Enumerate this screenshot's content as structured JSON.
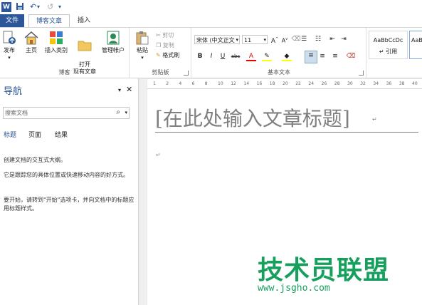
{
  "qat": {
    "undo_glyph": "↶",
    "redo_glyph": "↺",
    "dropdown_glyph": "▾"
  },
  "tabs": {
    "file": "文件",
    "blog": "博客文章",
    "insert": "插入"
  },
  "ribbon": {
    "blog_group": {
      "label": "博客",
      "publish": "发布",
      "home": "主页",
      "insert_category": "插入类别",
      "open_existing": "打开\n现有文章",
      "manage_accounts": "管理帐户"
    },
    "clipboard": {
      "label": "剪贴板",
      "paste": "粘贴",
      "cut": "剪切",
      "copy": "复制",
      "format_painter": "格式刷"
    },
    "basic_text": {
      "label": "基本文本",
      "font_name": "宋体 (中文正文",
      "font_size": "11",
      "bold": "B",
      "italic": "I",
      "underline": "U",
      "strike": "abc"
    },
    "styles": {
      "style1_sample": "AaBbCcDc",
      "style1_name": "↵ 引用",
      "style2_sample": "AaB"
    }
  },
  "nav": {
    "title": "导航",
    "search_placeholder": "搜索文档",
    "tabs": [
      "标题",
      "页面",
      "结果"
    ],
    "line1": "创建文档的交互式大纲。",
    "line2": "它是跟踪您的具体位置或快速移动内容的好方式。",
    "line3": "要开始，请转到\"开始\"选项卡，并向文档中的标题应用标题样式。"
  },
  "ruler": {
    "ticks": [
      "1",
      "2",
      "4",
      "6",
      "8",
      "10",
      "12",
      "14",
      "16",
      "18",
      "20",
      "22",
      "24",
      "26",
      "28",
      "30",
      "32",
      "34",
      "36",
      "38",
      "40"
    ]
  },
  "doc": {
    "title_placeholder": "[在此处输入文章标题]",
    "para_mark": "↵"
  },
  "watermark": {
    "name": "技术员联盟",
    "url": "www.jsgho.com"
  },
  "colors": {
    "accent": "#2b579a",
    "watermark": "#17a05d"
  }
}
